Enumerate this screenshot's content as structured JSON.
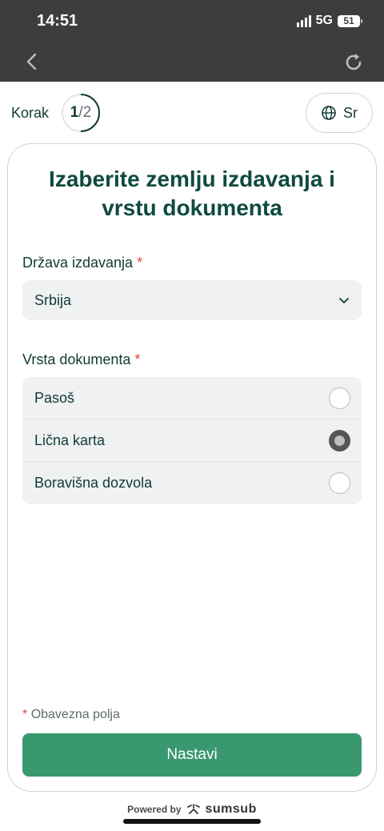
{
  "status_bar": {
    "time": "14:51",
    "network": "5G",
    "battery": "51"
  },
  "icons": {
    "back": "chevron-left-icon",
    "reload": "reload-icon",
    "globe": "globe-icon",
    "chevron": "chevron-down-icon",
    "brand": "sumsub-logo-icon"
  },
  "step": {
    "label": "Korak",
    "current": "1",
    "separator": "/",
    "total": "2",
    "progress": 0.5
  },
  "language": {
    "label": "Sr"
  },
  "card": {
    "title": "Izaberite zemlju izdavanja i vrstu dokumenta",
    "country_field": {
      "label": "Država izdavanja",
      "required_mark": "*",
      "value": "Srbija"
    },
    "doc_type_field": {
      "label": "Vrsta dokumenta",
      "required_mark": "*",
      "options": [
        {
          "label": "Pasoš",
          "checked": false
        },
        {
          "label": "Lična karta",
          "checked": true
        },
        {
          "label": "Boravišna dozvola",
          "checked": false
        }
      ]
    },
    "required_note": {
      "mark": "*",
      "text": "Obavezna polja"
    },
    "continue_label": "Nastavi"
  },
  "footer": {
    "powered_by": "Powered by",
    "brand": "sumsub"
  },
  "colors": {
    "primary": "#3a9870",
    "title": "#0f4a3f",
    "required": "#e0443e",
    "status_bar": "#3d3d3d"
  }
}
